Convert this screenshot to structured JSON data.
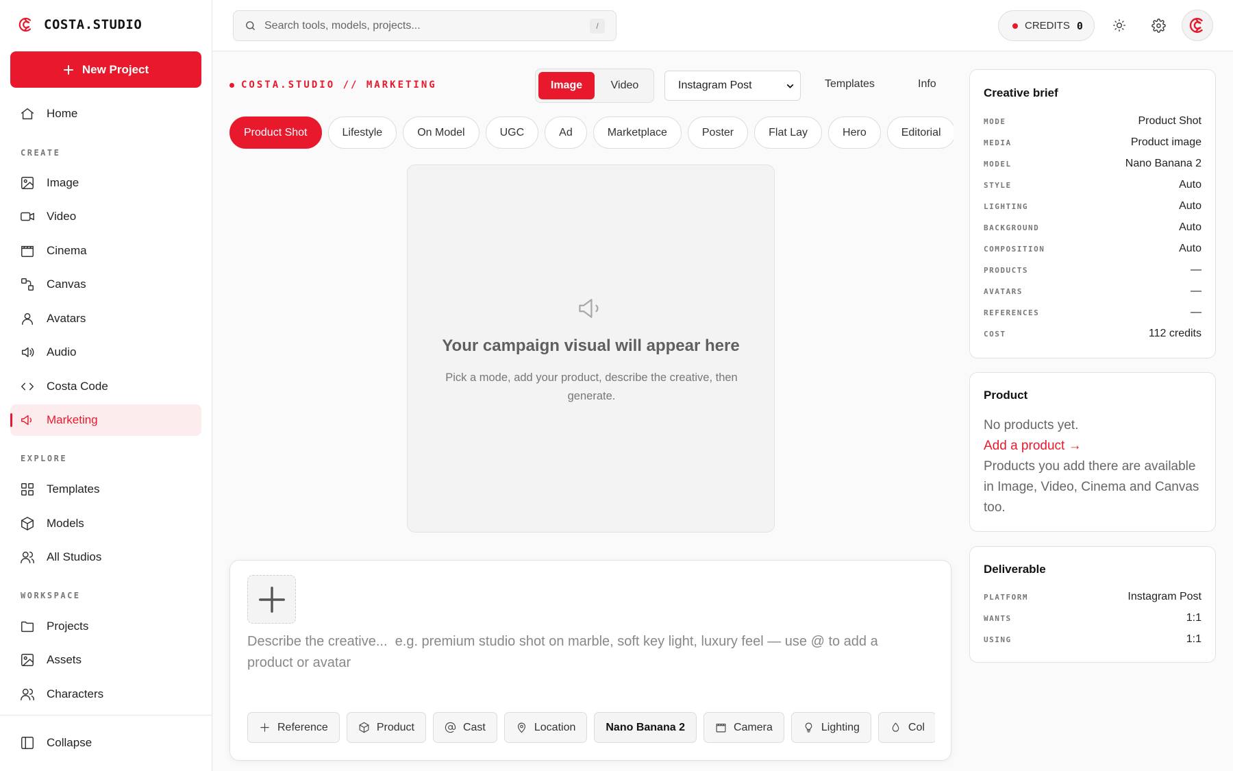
{
  "brand": {
    "name": "COSTA.STUDIO"
  },
  "sidebar": {
    "new_project": "New Project",
    "home": "Home",
    "sections": {
      "create": "CREATE",
      "explore": "EXPLORE",
      "workspace": "WORKSPACE"
    },
    "create_items": [
      "Image",
      "Video",
      "Cinema",
      "Canvas",
      "Avatars",
      "Audio",
      "Costa Code",
      "Marketing"
    ],
    "explore_items": [
      "Templates",
      "Models",
      "All Studios"
    ],
    "workspace_items": [
      "Projects",
      "Assets",
      "Characters"
    ],
    "collapse": "Collapse",
    "active_item": "Marketing"
  },
  "topbar": {
    "search_placeholder": "Search tools, models, projects...",
    "search_shortcut": "/",
    "credits_label": "CREDITS",
    "credits_value": "0"
  },
  "header": {
    "breadcrumb": "COSTA.STUDIO // MARKETING",
    "media_toggle": [
      "Image",
      "Video"
    ],
    "media_selected": "Image",
    "format_select": "Instagram Post",
    "links": [
      "Templates",
      "Info"
    ]
  },
  "modes": [
    "Product Shot",
    "Lifestyle",
    "On Model",
    "UGC",
    "Ad",
    "Marketplace",
    "Poster",
    "Flat Lay",
    "Hero",
    "Editorial"
  ],
  "mode_selected": "Product Shot",
  "preview": {
    "title": "Your campaign visual will appear here",
    "subtitle": "Pick a mode, add your product, describe the creative, then generate."
  },
  "composer": {
    "placeholder": "Describe the creative...  e.g. premium studio shot on marble, soft key light, luxury feel — use @ to add a product or avatar",
    "tools": [
      "Reference",
      "Product",
      "Cast",
      "Location",
      "Nano Banana 2",
      "Camera",
      "Lighting",
      "Col"
    ]
  },
  "brief": {
    "title": "Creative brief",
    "rows": [
      {
        "k": "MODE",
        "v": "Product Shot"
      },
      {
        "k": "MEDIA",
        "v": "Product image"
      },
      {
        "k": "MODEL",
        "v": "Nano Banana 2"
      },
      {
        "k": "STYLE",
        "v": "Auto"
      },
      {
        "k": "LIGHTING",
        "v": "Auto"
      },
      {
        "k": "BACKGROUND",
        "v": "Auto"
      },
      {
        "k": "COMPOSITION",
        "v": "Auto"
      },
      {
        "k": "PRODUCTS",
        "v": "—"
      },
      {
        "k": "AVATARS",
        "v": "—"
      },
      {
        "k": "REFERENCES",
        "v": "—"
      },
      {
        "k": "COST",
        "v": "112 credits"
      }
    ]
  },
  "product_panel": {
    "title": "Product",
    "empty": "No products yet.",
    "link": "Add a product →",
    "note": "Products you add there are available in Image, Video, Cinema and Canvas too."
  },
  "deliverable": {
    "title": "Deliverable",
    "rows": [
      {
        "k": "PLATFORM",
        "v": "Instagram Post"
      },
      {
        "k": "WANTS",
        "v": "1:1"
      },
      {
        "k": "USING",
        "v": "1:1"
      }
    ]
  },
  "colors": {
    "accent": "#e8192c",
    "accent_soft": "#fdecee"
  }
}
